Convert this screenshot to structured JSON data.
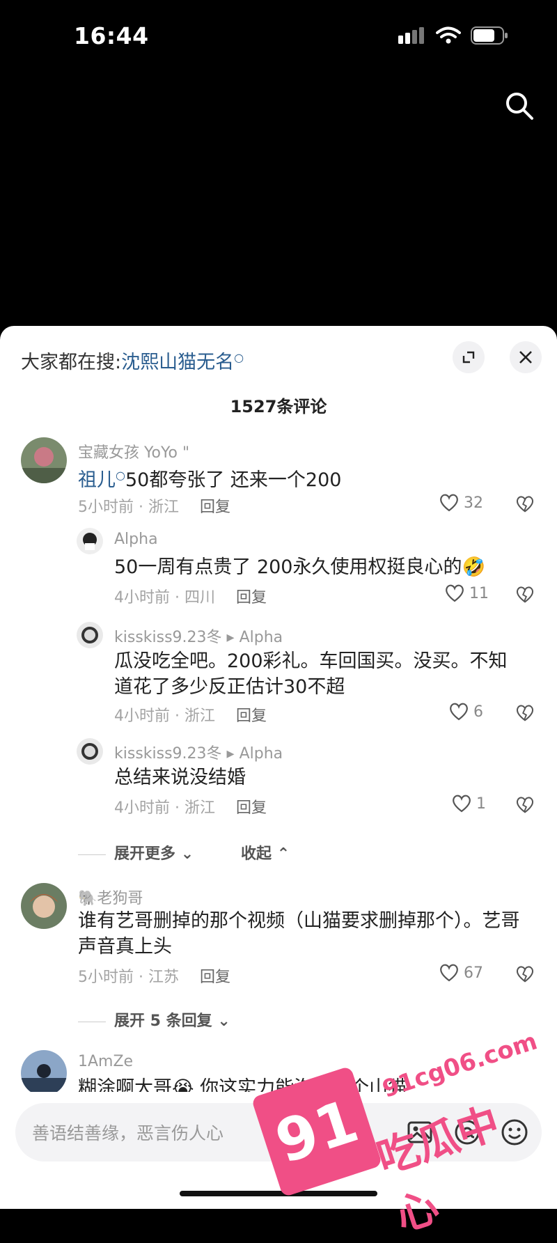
{
  "status_bar": {
    "time": "16:44"
  },
  "header": {
    "hot_search_prefix": "大家都在搜:",
    "hot_search_term": "沈熙山猫无名",
    "comment_count": "1527条评论"
  },
  "comments": [
    {
      "username": "宝藏女孩 YoYo \"",
      "text_highlight": "祖儿",
      "text": "50都夸张了 还来一个200",
      "meta": "5小时前 · 浙江",
      "reply_label": "回复",
      "likes": "32",
      "replies": [
        {
          "username": "Alpha",
          "text": "50一周有点贵了 200永久使用权挺良心的🤣",
          "meta": "4小时前 · 四川",
          "reply_label": "回复",
          "likes": "11"
        },
        {
          "username": "kisskiss9.23冬",
          "reply_to": "Alpha",
          "text": "瓜没吃全吧。200彩礼。车回国买。没买。不知道花了多少反正估计30不超",
          "meta": "4小时前 · 浙江",
          "reply_label": "回复",
          "likes": "6"
        },
        {
          "username": "kisskiss9.23冬",
          "reply_to": "Alpha",
          "text": "总结来说没结婚",
          "meta": "4小时前 · 浙江",
          "reply_label": "回复",
          "likes": "1"
        }
      ],
      "expand_more": "展开更多",
      "collapse": "收起"
    },
    {
      "username": "老狗哥",
      "text": "谁有艺哥删掉的那个视频（山猫要求删掉那个）。艺哥声音真上头",
      "meta": "5小时前 · 江苏",
      "reply_label": "回复",
      "likes": "67",
      "expand_replies": "展开 5 条回复"
    },
    {
      "username": "1AmZe",
      "text": "糊涂啊大哥😭 你这实力能泡多少个山猫"
    }
  ],
  "input": {
    "placeholder": "善语结善缘，恶言伤人心"
  },
  "watermark": {
    "number": "91",
    "url": "91cg06.com",
    "name": "吃瓜中心"
  },
  "colors": {
    "accent_link": "#2a5d8f",
    "watermark": "#f04f86"
  }
}
